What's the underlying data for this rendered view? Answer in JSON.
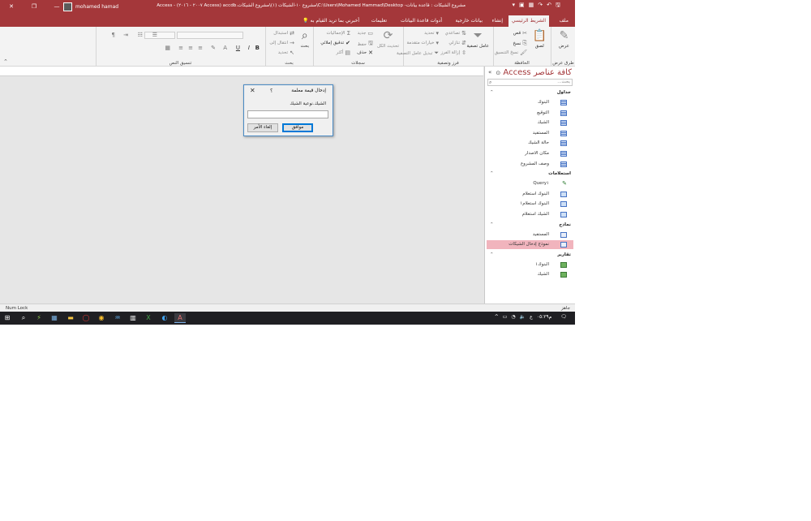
{
  "titlebar": {
    "title": "مشروع الشيكات : قاعدة بيانات- C:\\Users\\Mohamed Hammad\\Desktop\\مشروع ١٠-الشيكات (١)\\مشروع الشيكات.accdb (Access ٢٠٠٧ - ٢٠١٦) - Access",
    "user": "mohamed hamad",
    "close_icon": "close-icon",
    "restore_icon": "restore-icon",
    "minimize_icon": "minimize-icon"
  },
  "tabs": [
    {
      "label": "ملف"
    },
    {
      "label": "الشريط الرئيسي",
      "active": true
    },
    {
      "label": "إنشاء"
    },
    {
      "label": "بيانات خارجية"
    },
    {
      "label": "أدوات قاعدة البيانات"
    },
    {
      "label": "تعليمات"
    },
    {
      "label": "أخبرني بما تريد القيام به"
    }
  ],
  "ribbon": {
    "views": {
      "label": "طرق عرض",
      "button": "عرض"
    },
    "clipboard": {
      "label": "الحافظة",
      "paste": "لصق",
      "cut": "قص",
      "copy": "نسخ",
      "format_painter": "نسخ التنسيق"
    },
    "sort_filter": {
      "label": "فرز وتصفية",
      "filter": "عامل تصفية",
      "ascending": "تصاعدي",
      "descending": "تنازلي",
      "remove_sort": "إزالة الفرز",
      "selection": "تحديد",
      "advanced": "خيارات متقدمة",
      "toggle_filter": "تبديل عامل التصفية"
    },
    "records": {
      "label": "سجلات",
      "refresh": "تحديث الكل",
      "new": "جديد",
      "save": "حفظ",
      "delete": "حذف",
      "totals": "الإجماليات",
      "spelling": "تدقيق إملائي",
      "more": "أكثر"
    },
    "find": {
      "label": "بحث",
      "find": "بحث",
      "replace": "استبدال",
      "goto": "انتقال إلى",
      "select": "تحديد"
    },
    "text_format": {
      "label": "تنسيق النص",
      "bold": "B",
      "italic": "I",
      "underline": "U"
    }
  },
  "nav": {
    "header": "كافة عناصر Access",
    "search_placeholder": "بحث...",
    "groups": [
      {
        "label": "جداول",
        "items": [
          "البنوك",
          "التوقيع",
          "الشيك",
          "المستفيد",
          "حالة الشيك",
          "مكان الاصدار",
          "وصف المشروع"
        ]
      },
      {
        "label": "استعلامات",
        "items": [
          "Query١",
          "البنوك استعلام",
          "البنوك استعلام١",
          "الشيك استعلام"
        ]
      },
      {
        "label": "نماذج",
        "items": [
          "المستفيد",
          "نموذج إدخال الشيكات"
        ]
      },
      {
        "label": "تقارير",
        "items": [
          "البنوك١",
          "الشيك"
        ]
      }
    ]
  },
  "dialog": {
    "title": "إدخال قيمة معلمة",
    "help": "؟",
    "prompt": "الشيك.نوعية الشيك",
    "value": "",
    "ok": "موافق",
    "cancel": "إلغاء الأمر"
  },
  "status": {
    "left": "Num Lock",
    "right": "جاهز"
  },
  "taskbar": {
    "clock": "م٠٥:٢٩",
    "lang": "ع"
  }
}
